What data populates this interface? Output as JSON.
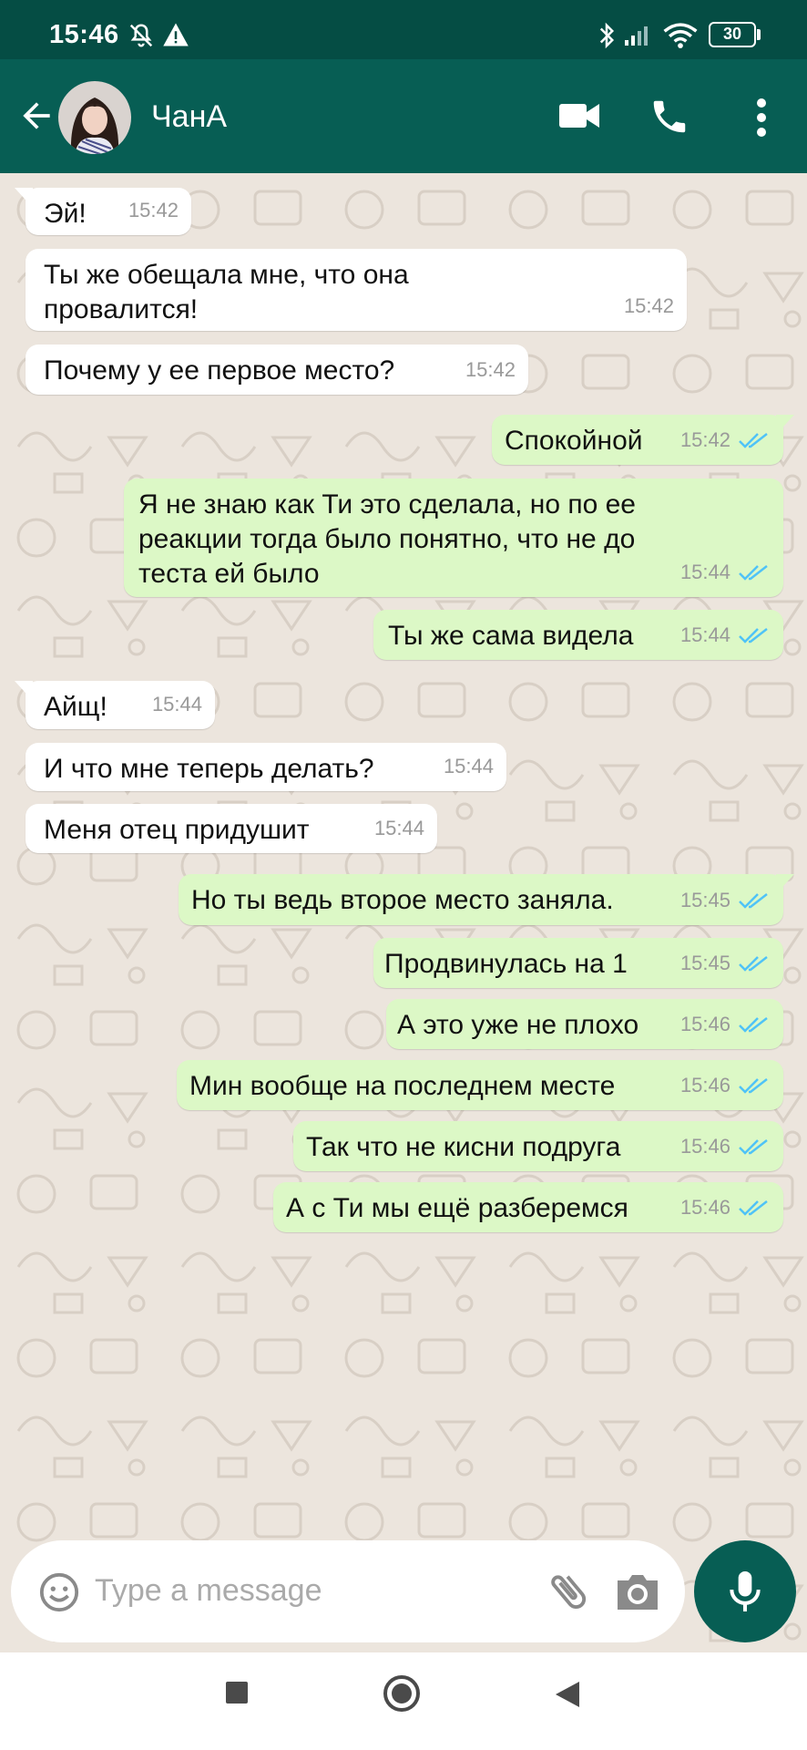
{
  "status_bar": {
    "time": "15:46",
    "battery": "30"
  },
  "header": {
    "contact_name": "ЧанА"
  },
  "messages": [
    {
      "dir": "in",
      "text": "Эй!",
      "time": "15:42"
    },
    {
      "dir": "in",
      "text": "Ты же обещала мне, что она\nпровалится!",
      "time": "15:42"
    },
    {
      "dir": "in",
      "text": "Почему у ее первое место?",
      "time": "15:42"
    },
    {
      "dir": "out",
      "text": "Спокойной",
      "time": "15:42"
    },
    {
      "dir": "out",
      "text": "Я не знаю как Ти это сделала, но по ее\nреакции тогда было понятно, что не до\nтеста ей было",
      "time": "15:44"
    },
    {
      "dir": "out",
      "text": "Ты же сама видела",
      "time": "15:44"
    },
    {
      "dir": "in",
      "text": "Айщ!",
      "time": "15:44"
    },
    {
      "dir": "in",
      "text": "И что мне теперь делать?",
      "time": "15:44"
    },
    {
      "dir": "in",
      "text": "Меня отец придушит",
      "time": "15:44"
    },
    {
      "dir": "out",
      "text": "Но ты ведь второе место заняла.",
      "time": "15:45"
    },
    {
      "dir": "out",
      "text": "Продвинулась на 1",
      "time": "15:45"
    },
    {
      "dir": "out",
      "text": "А это уже не плохо",
      "time": "15:46"
    },
    {
      "dir": "out",
      "text": "Мин вообще на последнем месте",
      "time": "15:46"
    },
    {
      "dir": "out",
      "text": "Так что не кисни подруга",
      "time": "15:46"
    },
    {
      "dir": "out",
      "text": "А с Ти мы ещё разберемся",
      "time": "15:46"
    }
  ],
  "composer": {
    "placeholder": "Type a message"
  },
  "colors": {
    "header": "#075e54",
    "status_bar": "#054d44",
    "outgoing_bubble": "#dcf8c6",
    "incoming_bubble": "#ffffff",
    "read_ticks": "#4fc3f7"
  },
  "icons": [
    "back-arrow-icon",
    "video-call-icon",
    "phone-icon",
    "more-vert-icon",
    "emoji-icon",
    "attach-icon",
    "camera-icon",
    "mic-icon"
  ]
}
